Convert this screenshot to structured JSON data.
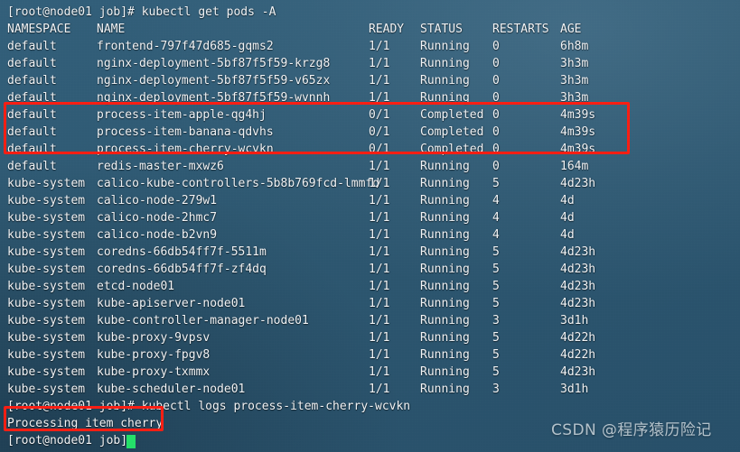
{
  "terminal": {
    "background_color": "#2e5871",
    "text_color": "#f2f4f6",
    "highlight_color": "#fb1f14",
    "cursor_color": "#25e06a",
    "prompt": "[root@node01 job]#",
    "commands": {
      "get_pods": "[root@node01 job]# kubectl get pods -A",
      "logs": "[root@node01 job]# kubectl logs process-item-cherry-wcvkn",
      "final_prompt": "[root@node01 job]#"
    },
    "log_output": "Processing item cherry"
  },
  "table": {
    "headers": {
      "namespace": "NAMESPACE",
      "name": "NAME",
      "ready": "READY",
      "status": "STATUS",
      "restarts": "RESTARTS",
      "age": "AGE"
    },
    "rows": [
      {
        "namespace": "default",
        "name": "frontend-797f47d685-gqms2",
        "ready": "1/1",
        "status": "Running",
        "restarts": "0",
        "age": "6h8m",
        "highlighted": false
      },
      {
        "namespace": "default",
        "name": "nginx-deployment-5bf87f5f59-krzg8",
        "ready": "1/1",
        "status": "Running",
        "restarts": "0",
        "age": "3h3m",
        "highlighted": false
      },
      {
        "namespace": "default",
        "name": "nginx-deployment-5bf87f5f59-v65zx",
        "ready": "1/1",
        "status": "Running",
        "restarts": "0",
        "age": "3h3m",
        "highlighted": false
      },
      {
        "namespace": "default",
        "name": "nginx-deployment-5bf87f5f59-wvnnh",
        "ready": "1/1",
        "status": "Running",
        "restarts": "0",
        "age": "3h3m",
        "highlighted": false
      },
      {
        "namespace": "default",
        "name": "process-item-apple-qg4hj",
        "ready": "0/1",
        "status": "Completed",
        "restarts": "0",
        "age": "4m39s",
        "highlighted": true
      },
      {
        "namespace": "default",
        "name": "process-item-banana-qdvhs",
        "ready": "0/1",
        "status": "Completed",
        "restarts": "0",
        "age": "4m39s",
        "highlighted": true
      },
      {
        "namespace": "default",
        "name": "process-item-cherry-wcvkn",
        "ready": "0/1",
        "status": "Completed",
        "restarts": "0",
        "age": "4m39s",
        "highlighted": true
      },
      {
        "namespace": "default",
        "name": "redis-master-mxwz6",
        "ready": "1/1",
        "status": "Running",
        "restarts": "0",
        "age": "164m",
        "highlighted": false
      },
      {
        "namespace": "kube-system",
        "name": "calico-kube-controllers-5b8b769fcd-lmmfd",
        "ready": "1/1",
        "status": "Running",
        "restarts": "5",
        "age": "4d23h",
        "highlighted": false
      },
      {
        "namespace": "kube-system",
        "name": "calico-node-279w1",
        "ready": "1/1",
        "status": "Running",
        "restarts": "4",
        "age": "4d",
        "highlighted": false
      },
      {
        "namespace": "kube-system",
        "name": "calico-node-2hmc7",
        "ready": "1/1",
        "status": "Running",
        "restarts": "4",
        "age": "4d",
        "highlighted": false
      },
      {
        "namespace": "kube-system",
        "name": "calico-node-b2vn9",
        "ready": "1/1",
        "status": "Running",
        "restarts": "4",
        "age": "4d",
        "highlighted": false
      },
      {
        "namespace": "kube-system",
        "name": "coredns-66db54ff7f-5511m",
        "ready": "1/1",
        "status": "Running",
        "restarts": "5",
        "age": "4d23h",
        "highlighted": false
      },
      {
        "namespace": "kube-system",
        "name": "coredns-66db54ff7f-zf4dq",
        "ready": "1/1",
        "status": "Running",
        "restarts": "5",
        "age": "4d23h",
        "highlighted": false
      },
      {
        "namespace": "kube-system",
        "name": "etcd-node01",
        "ready": "1/1",
        "status": "Running",
        "restarts": "5",
        "age": "4d23h",
        "highlighted": false
      },
      {
        "namespace": "kube-system",
        "name": "kube-apiserver-node01",
        "ready": "1/1",
        "status": "Running",
        "restarts": "5",
        "age": "4d23h",
        "highlighted": false
      },
      {
        "namespace": "kube-system",
        "name": "kube-controller-manager-node01",
        "ready": "1/1",
        "status": "Running",
        "restarts": "3",
        "age": "3d1h",
        "highlighted": false
      },
      {
        "namespace": "kube-system",
        "name": "kube-proxy-9vpsv",
        "ready": "1/1",
        "status": "Running",
        "restarts": "5",
        "age": "4d22h",
        "highlighted": false
      },
      {
        "namespace": "kube-system",
        "name": "kube-proxy-fpgv8",
        "ready": "1/1",
        "status": "Running",
        "restarts": "5",
        "age": "4d22h",
        "highlighted": false
      },
      {
        "namespace": "kube-system",
        "name": "kube-proxy-txmmx",
        "ready": "1/1",
        "status": "Running",
        "restarts": "5",
        "age": "4d23h",
        "highlighted": false
      },
      {
        "namespace": "kube-system",
        "name": "kube-scheduler-node01",
        "ready": "1/1",
        "status": "Running",
        "restarts": "3",
        "age": "3d1h",
        "highlighted": false
      }
    ]
  },
  "watermark": {
    "text": "CSDN @程序猿历险记"
  }
}
